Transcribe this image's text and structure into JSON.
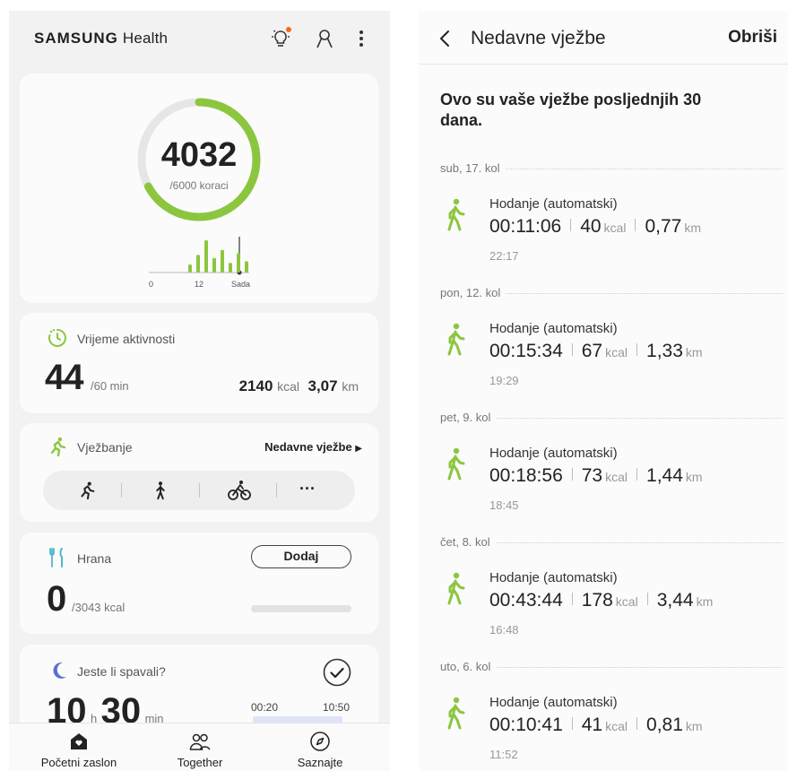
{
  "left": {
    "brand_bold": "SAMSUNG",
    "brand_light": "Health",
    "steps": {
      "count": "4032",
      "goal": "/6000 koraci",
      "progress": 0.672,
      "hist_labels": [
        "0",
        "12",
        "Sada"
      ],
      "hist_values": [
        0.25,
        0.55,
        1.0,
        0.45,
        0.7,
        0.3,
        0.6,
        0.35
      ]
    },
    "activity": {
      "title": "Vrijeme aktivnosti",
      "minutes": "44",
      "goal": "/60 min",
      "kcal_value": "2140",
      "kcal_unit": "kcal",
      "km_value": "3,07",
      "km_unit": "km"
    },
    "exercise": {
      "title": "Vježbanje",
      "recent_link": "Nedavne vježbe",
      "more": "···"
    },
    "food": {
      "title": "Hrana",
      "add_button": "Dodaj",
      "value": "0",
      "goal": "/3043 kcal"
    },
    "sleep": {
      "title": "Jeste li spavali?",
      "hours": "10",
      "h_unit": "h",
      "minutes": "30",
      "min_unit": "min",
      "start": "00:20",
      "end": "10:50"
    },
    "nav": [
      {
        "label": "Početni zaslon"
      },
      {
        "label": "Together"
      },
      {
        "label": "Saznajte"
      }
    ]
  },
  "right": {
    "title": "Nedavne vježbe",
    "delete": "Obriši",
    "intro": "Ovo su vaše vježbe posljednjih 30 dana.",
    "days": [
      {
        "date": "sub, 17. kol",
        "name": "Hodanje (automatski)",
        "duration": "00:11:06",
        "kcal": "40",
        "km": "0,77",
        "time": "22:17"
      },
      {
        "date": "pon, 12. kol",
        "name": "Hodanje (automatski)",
        "duration": "00:15:34",
        "kcal": "67",
        "km": "1,33",
        "time": "19:29"
      },
      {
        "date": "pet, 9. kol",
        "name": "Hodanje (automatski)",
        "duration": "00:18:56",
        "kcal": "73",
        "km": "1,44",
        "time": "18:45"
      },
      {
        "date": "čet, 8. kol",
        "name": "Hodanje (automatski)",
        "duration": "00:43:44",
        "kcal": "178",
        "km": "3,44",
        "time": "16:48"
      },
      {
        "date": "uto, 6. kol",
        "name": "Hodanje (automatski)",
        "duration": "00:10:41",
        "kcal": "41",
        "km": "0,81",
        "time": "11:52"
      }
    ],
    "kcal_unit": "kcal",
    "km_unit": "km"
  },
  "colors": {
    "accent_green": "#8cc63f",
    "ring_track": "#e6e6e6",
    "notification_dot": "#f26b1d"
  }
}
